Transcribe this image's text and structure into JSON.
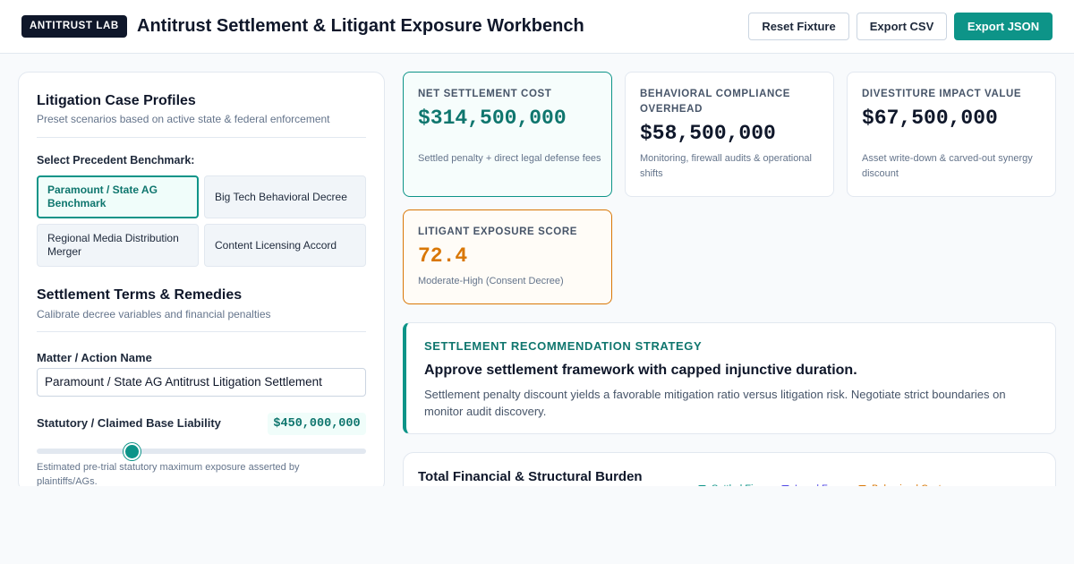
{
  "header": {
    "badge": "ANTITRUST LAB",
    "title": "Antitrust Settlement & Litigant Exposure Workbench",
    "buttons": {
      "reset": "Reset Fixture",
      "export_csv": "Export CSV",
      "export_json": "Export JSON"
    }
  },
  "case_profiles": {
    "title": "Litigation Case Profiles",
    "subtitle": "Preset scenarios based on active state & federal enforcement",
    "benchmark_label": "Select Precedent Benchmark:",
    "presets": [
      {
        "label": "Paramount / State AG Benchmark",
        "active": true
      },
      {
        "label": "Big Tech Behavioral Decree",
        "active": false
      },
      {
        "label": "Regional Media Distribution Merger",
        "active": false
      },
      {
        "label": "Content Licensing Accord",
        "active": false
      }
    ]
  },
  "terms": {
    "title": "Settlement Terms & Remedies",
    "subtitle": "Calibrate decree variables and financial penalties",
    "matter_label": "Matter / Action Name",
    "matter_value": "Paramount / State AG Antitrust Litigation Settlement",
    "liability_label": "Statutory / Claimed Base Liability",
    "liability_value": "$450,000,000",
    "liability_slider_fraction": 0.29,
    "liability_help": "Estimated pre-trial statutory maximum exposure asserted by plaintiffs/AGs."
  },
  "metrics": {
    "net_settlement": {
      "label": "NET SETTLEMENT COST",
      "value": "$314,500,000",
      "note": "Settled penalty + direct legal defense fees"
    },
    "behavioral": {
      "label": "BEHAVIORAL COMPLIANCE OVERHEAD",
      "value": "$58,500,000",
      "note": "Monitoring, firewall audits & operational shifts"
    },
    "divestiture": {
      "label": "DIVESTITURE IMPACT VALUE",
      "value": "$67,500,000",
      "note": "Asset write-down & carved-out synergy discount"
    },
    "exposure": {
      "label": "LITIGANT EXPOSURE SCORE",
      "value": "72.4",
      "note": "Moderate-High (Consent Decree)"
    }
  },
  "recommendation": {
    "kicker": "SETTLEMENT RECOMMENDATION STRATEGY",
    "headline": "Approve settlement framework with capped injunctive duration.",
    "body": "Settlement penalty discount yields a favorable mitigation ratio versus litigation risk. Negotiate strict boundaries on monitor audit discovery."
  },
  "burden_chart": {
    "title": "Total Financial & Structural Burden",
    "legend": [
      {
        "label": "Settled Fines",
        "color": "#0d9488"
      },
      {
        "label": "Legal Fees",
        "color": "#4f46e5"
      },
      {
        "label": "Behavioral Costs",
        "color": "#d97706"
      }
    ]
  },
  "colors": {
    "accent": "#0d9488",
    "warning": "#d97706",
    "ink": "#0f172a"
  }
}
